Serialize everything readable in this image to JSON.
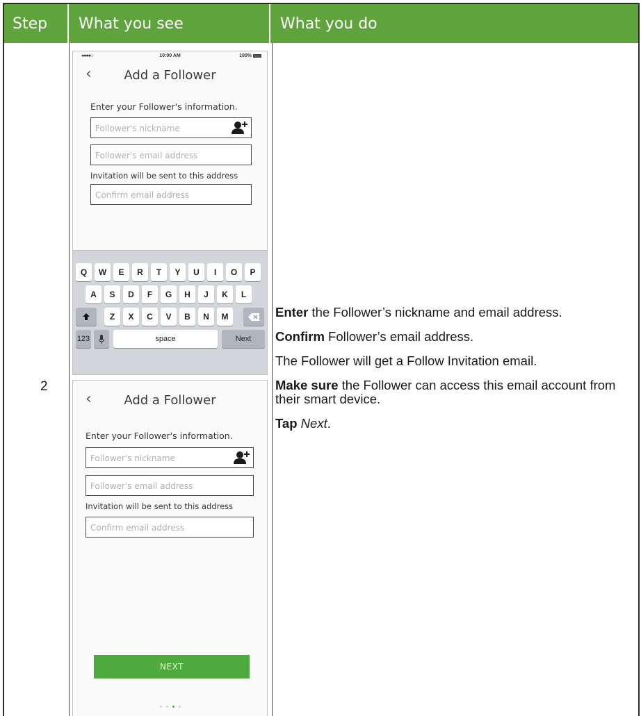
{
  "header": {
    "step_label": "Step",
    "see_label": "What you see",
    "do_label": "What you do"
  },
  "step_number": "2",
  "colors": {
    "header_green": "#5ea33c",
    "button_green": "#4eaa3c"
  },
  "screen1": {
    "status": {
      "signal": "●●●●○",
      "time": "10:00 AM",
      "battery": "100%"
    },
    "title": "Add a Follower",
    "back_icon": "chevron-left-icon",
    "instruction": "Enter your Follower's information.",
    "nickname_placeholder": "Follower's nickname",
    "email_placeholder": "Follower's email address",
    "note": "Invitation will be sent to this address",
    "confirm_placeholder": "Confirm email address",
    "keyboard": {
      "row1": [
        "Q",
        "W",
        "E",
        "R",
        "T",
        "Y",
        "U",
        "I",
        "O",
        "P"
      ],
      "row2": [
        "A",
        "S",
        "D",
        "F",
        "G",
        "H",
        "J",
        "K",
        "L"
      ],
      "row3": [
        "Z",
        "X",
        "C",
        "V",
        "B",
        "N",
        "M"
      ],
      "numbers": "123",
      "space": "space",
      "next": "Next"
    }
  },
  "screen2": {
    "title": "Add a Follower",
    "instruction": "Enter your Follower's information.",
    "nickname_placeholder": "Follower's nickname",
    "email_placeholder": "Follower's email address",
    "note": "Invitation will be sent to this address",
    "confirm_placeholder": "Confirm email address",
    "next_button": "NEXT"
  },
  "instructions": {
    "p1_bold": "Enter",
    "p1_rest": " the Follower’s nickname and email address.",
    "p2_bold": "Confirm",
    "p2_rest": " Follower’s email address.",
    "p3": "The Follower will get a Follow Invitation email.",
    "p4_bold": "Make sure",
    "p4_rest": " the Follower can access this email account from their smart device.",
    "p5_bold": "Tap",
    "p5_italic": "Next",
    "p5_end": "."
  }
}
